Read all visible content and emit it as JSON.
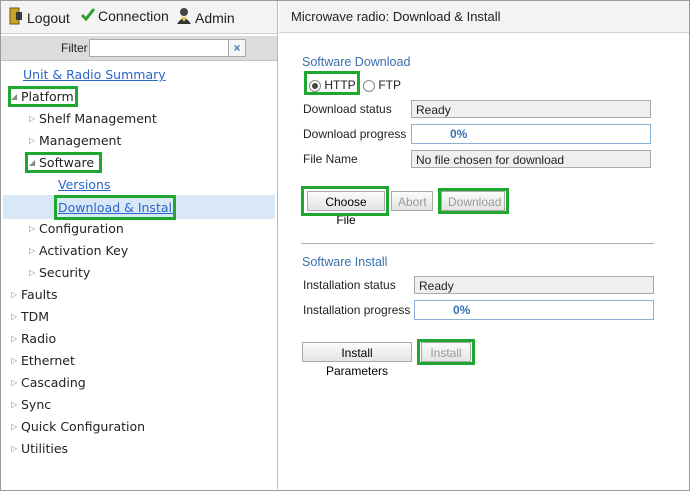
{
  "toolbar": {
    "logout_label": "Logout",
    "connection_label": "Connection",
    "admin_label": "Admin"
  },
  "filter": {
    "label": "Filter",
    "value": "",
    "clear_label": "×"
  },
  "nav": {
    "summary": "Unit & Radio Summary",
    "platform": "Platform",
    "shelf_management": "Shelf Management",
    "management": "Management",
    "software": "Software",
    "versions": "Versions",
    "download_install": "Download & Install",
    "configuration": "Configuration",
    "activation_key": "Activation Key",
    "security": "Security",
    "faults": "Faults",
    "tdm": "TDM",
    "radio": "Radio",
    "ethernet": "Ethernet",
    "cascading": "Cascading",
    "sync": "Sync",
    "quick_configuration": "Quick Configuration",
    "utilities": "Utilities"
  },
  "page": {
    "title": "Microwave radio: Download & Install"
  },
  "download": {
    "section_title": "Software Download",
    "protocol_http": "HTTP",
    "protocol_ftp": "FTP",
    "status_label": "Download status",
    "status_value": "Ready",
    "progress_label": "Download progress",
    "progress_value": "0%",
    "file_label": "File Name",
    "file_value": "No file chosen for download",
    "choose_file_button": "Choose File",
    "abort_button": "Abort",
    "download_button": "Download"
  },
  "install": {
    "section_title": "Software Install",
    "status_label": "Installation status",
    "status_value": "Ready",
    "progress_label": "Installation progress",
    "progress_value": "0%",
    "parameters_button": "Install Parameters",
    "install_button": "Install"
  },
  "colors": {
    "highlight": "#1fa82f",
    "link": "#2a66c8",
    "section_title": "#3b6fb0"
  }
}
